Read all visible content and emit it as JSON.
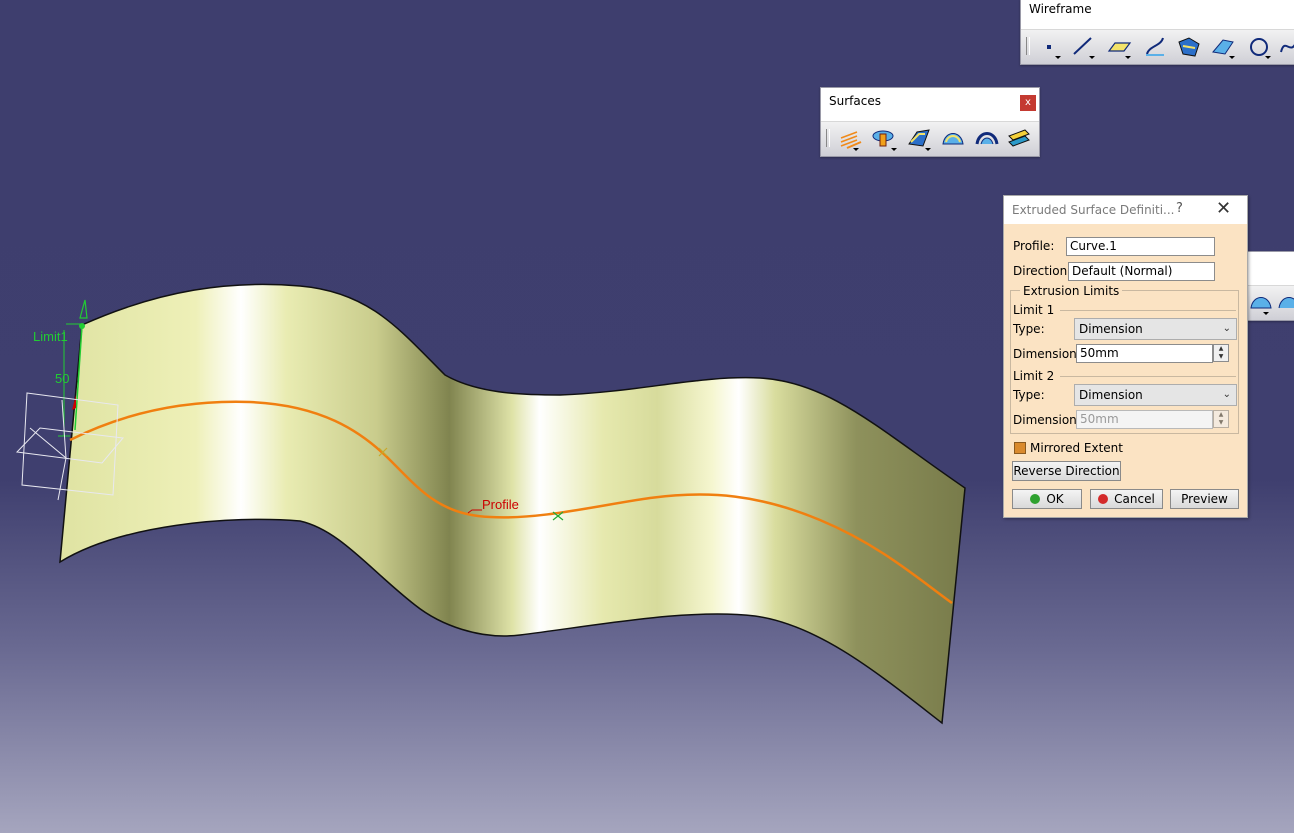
{
  "viewport": {
    "background_top": "#3e3e6e",
    "background_bottom": "#a5a5be",
    "surface_color": "#eef0b8",
    "profile_color": "#f07f10",
    "handle_color": "#22cc33",
    "label_color": "#cc0000",
    "profile_label": "Profile",
    "limit_label": "Limit1",
    "dimension_label": "50"
  },
  "toolbars": {
    "wireframe": {
      "title": "Wireframe",
      "icons": [
        "point-icon",
        "line-icon",
        "plane-icon",
        "projection-icon",
        "intersection-icon",
        "offset-icon",
        "circle-icon",
        "spline-icon"
      ]
    },
    "surfaces": {
      "title": "Surfaces",
      "close_label": "x",
      "icons": [
        "extrude-icon",
        "revolve-icon",
        "offset-surface-icon",
        "sweep-icon",
        "fill-icon",
        "multi-section-icon",
        "blend-icon"
      ]
    }
  },
  "dialog": {
    "title": "Extruded Surface Definiti...",
    "help": "?",
    "close": "✕",
    "profile_label": "Profile:",
    "profile_value": "Curve.1",
    "direction_label": "Direction:",
    "direction_value": "Default (Normal)",
    "limits_group": "Extrusion Limits",
    "limit1": {
      "header": "Limit 1",
      "type_label": "Type:",
      "type_value": "Dimension",
      "dimension_label": "Dimension:",
      "dimension_value": "50mm"
    },
    "limit2": {
      "header": "Limit 2",
      "type_label": "Type:",
      "type_value": "Dimension",
      "dimension_label": "Dimension:",
      "dimension_value": "50mm"
    },
    "mirrored_label": "Mirrored Extent",
    "mirrored_checked": true,
    "reverse_label": "Reverse Direction",
    "ok_label": "OK",
    "cancel_label": "Cancel",
    "preview_label": "Preview",
    "ok_color": "#2fa12f",
    "cancel_color": "#d42a2a"
  }
}
